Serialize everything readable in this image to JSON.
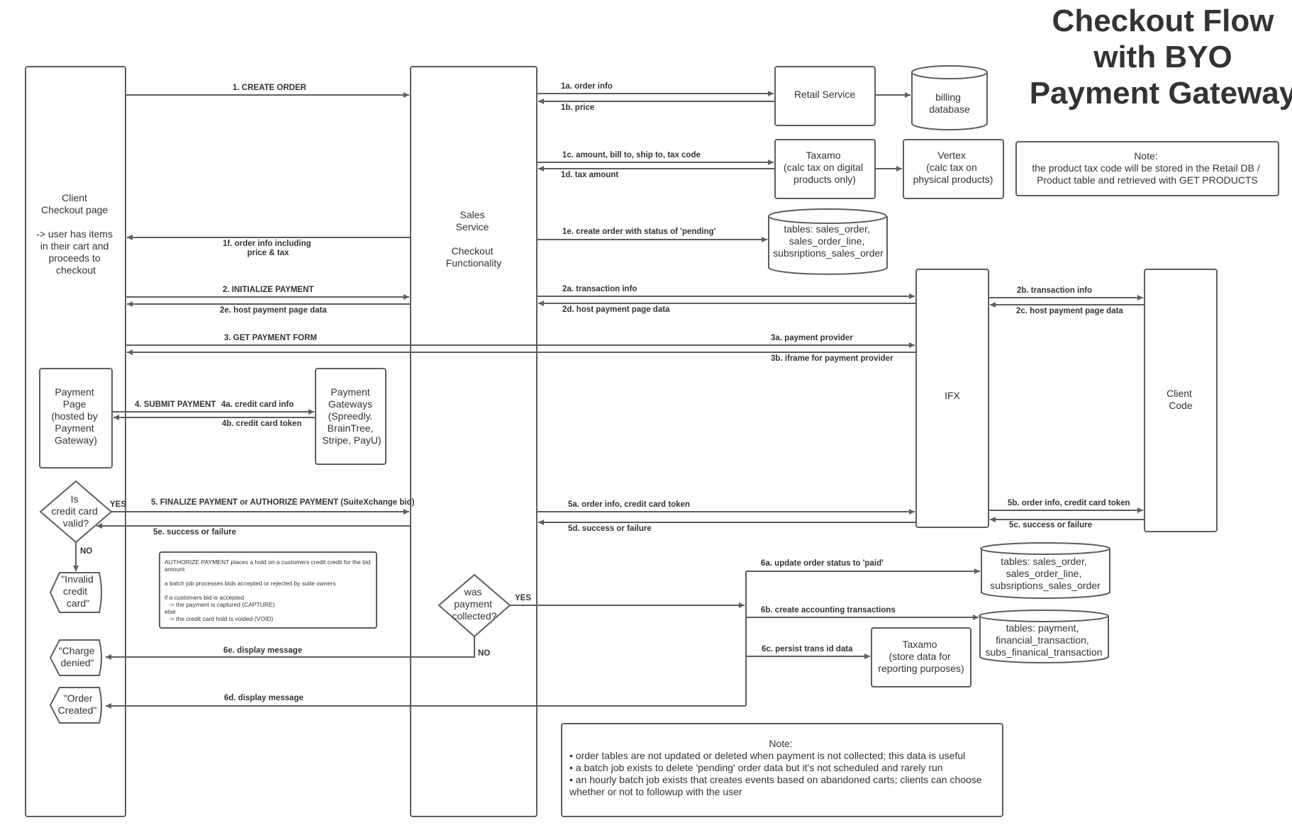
{
  "title": [
    "Checkout Flow",
    "with BYO",
    "Payment Gateway"
  ],
  "colors": {
    "stroke": "#5e5e5e",
    "text": "#333333",
    "background": "#ffffff"
  },
  "nodes": {
    "client_checkout": [
      "Client",
      "Checkout page",
      "",
      "-> user has items",
      "in their cart and",
      "proceeds to",
      "checkout"
    ],
    "sales_service": [
      "Sales",
      "Service",
      "",
      "Checkout",
      "Functionality"
    ],
    "retail_service": [
      "Retail Service"
    ],
    "billing_db": [
      "billing",
      "database"
    ],
    "taxamo_calc": [
      "Taxamo",
      "(calc tax on digital",
      "products only)"
    ],
    "vertex": [
      "Vertex",
      "(calc tax on",
      "physical products)"
    ],
    "tax_note": [
      "Note:",
      "the product tax code will be stored in the Retail DB /",
      "Product table and retrieved with GET PRODUCTS"
    ],
    "orders_db_pending": [
      "tables: sales_order,",
      "sales_order_line,",
      "subsriptions_sales_order"
    ],
    "ifx": [
      "IFX"
    ],
    "client_code": [
      "Client",
      "Code"
    ],
    "payment_page": [
      "Payment",
      "Page",
      "(hosted by",
      "Payment",
      "Gateway)"
    ],
    "payment_gateways": [
      "Payment",
      "Gateways",
      "(Spreedly.",
      "BrainTree,",
      "Stripe, PayU)"
    ],
    "cc_valid_decision": [
      "Is",
      "credit card",
      "valid?"
    ],
    "invalid_card_msg": [
      "\"Invalid",
      "credit",
      "card\""
    ],
    "charge_denied_msg": [
      "\"Charge",
      "denied\""
    ],
    "order_created_msg": [
      "\"Order",
      "Created\""
    ],
    "authorize_note": [
      "AUTHORIZE PAYMENT places a hold on a customers credit credit for the bid",
      "amount",
      "",
      "a batch job processes bids accepted or rejected by suite owners",
      "",
      "if a customers bid is accepted",
      "    -> the payment is captured (CAPTURE)",
      "else",
      "    -> the credit card hold is voided (VOID)"
    ],
    "payment_collected_decision": [
      "was",
      "payment",
      "collected?"
    ],
    "orders_db_paid": [
      "tables: sales_order,",
      "sales_order_line,",
      "subsriptions_sales_order"
    ],
    "finance_db": [
      "tables:  payment,",
      "financial_transaction,",
      "subs_finanical_transaction"
    ],
    "taxamo_store": [
      "Taxamo",
      "(store data for",
      "reporting purposes)"
    ],
    "bottom_note": [
      "Note:",
      "• order tables are not updated or deleted when payment is not collected; this data is useful",
      "• a batch job exists to delete 'pending' order data but it's not scheduled and rarely run",
      "• an hourly batch job exists that creates events based on abandoned carts; clients can choose",
      "   whether or not to followup with the user"
    ]
  },
  "edges": {
    "e1": "1. CREATE ORDER",
    "e1a": "1a. order info",
    "e1b": "1b. price",
    "e1c": "1c. amount, bill to, ship to, tax code",
    "e1d": "1d.  tax amount",
    "e1e": "1e. create order with status of 'pending'",
    "e1f": [
      "1f. order info including",
      "price & tax"
    ],
    "e2": "2. INITIALIZE PAYMENT",
    "e2a": "2a. transaction info",
    "e2b": "2b. transaction info",
    "e2c": "2c. host payment page data",
    "e2d": "2d. host payment page data",
    "e2e": "2e. host payment page data",
    "e3": "3. GET PAYMENT FORM",
    "e3a": "3a. payment provider",
    "e3b": "3b. iframe for payment provider",
    "e4": "4. SUBMIT PAYMENT",
    "e4a": "4a. credit card info",
    "e4b": "4b. credit card token",
    "e5": "5. FINALIZE PAYMENT or AUTHORIZE PAYMENT (SuiteXchange bid)",
    "e5a": "5a. order info, credit card token",
    "e5b": "5b. order info, credit card token",
    "e5c": "5c. success or failure",
    "e5d": "5d. success or failure",
    "e5e": "5e.  success or failure",
    "e6a": "6a. update order status to 'paid'",
    "e6b": "6b. create accounting transactions",
    "e6c": "6c. persist trans id data",
    "e6d": "6d. display message",
    "e6e": "6e. display message",
    "yes_cc": "YES",
    "no_cc": "NO",
    "yes_paid": "YES",
    "no_paid": "NO"
  }
}
